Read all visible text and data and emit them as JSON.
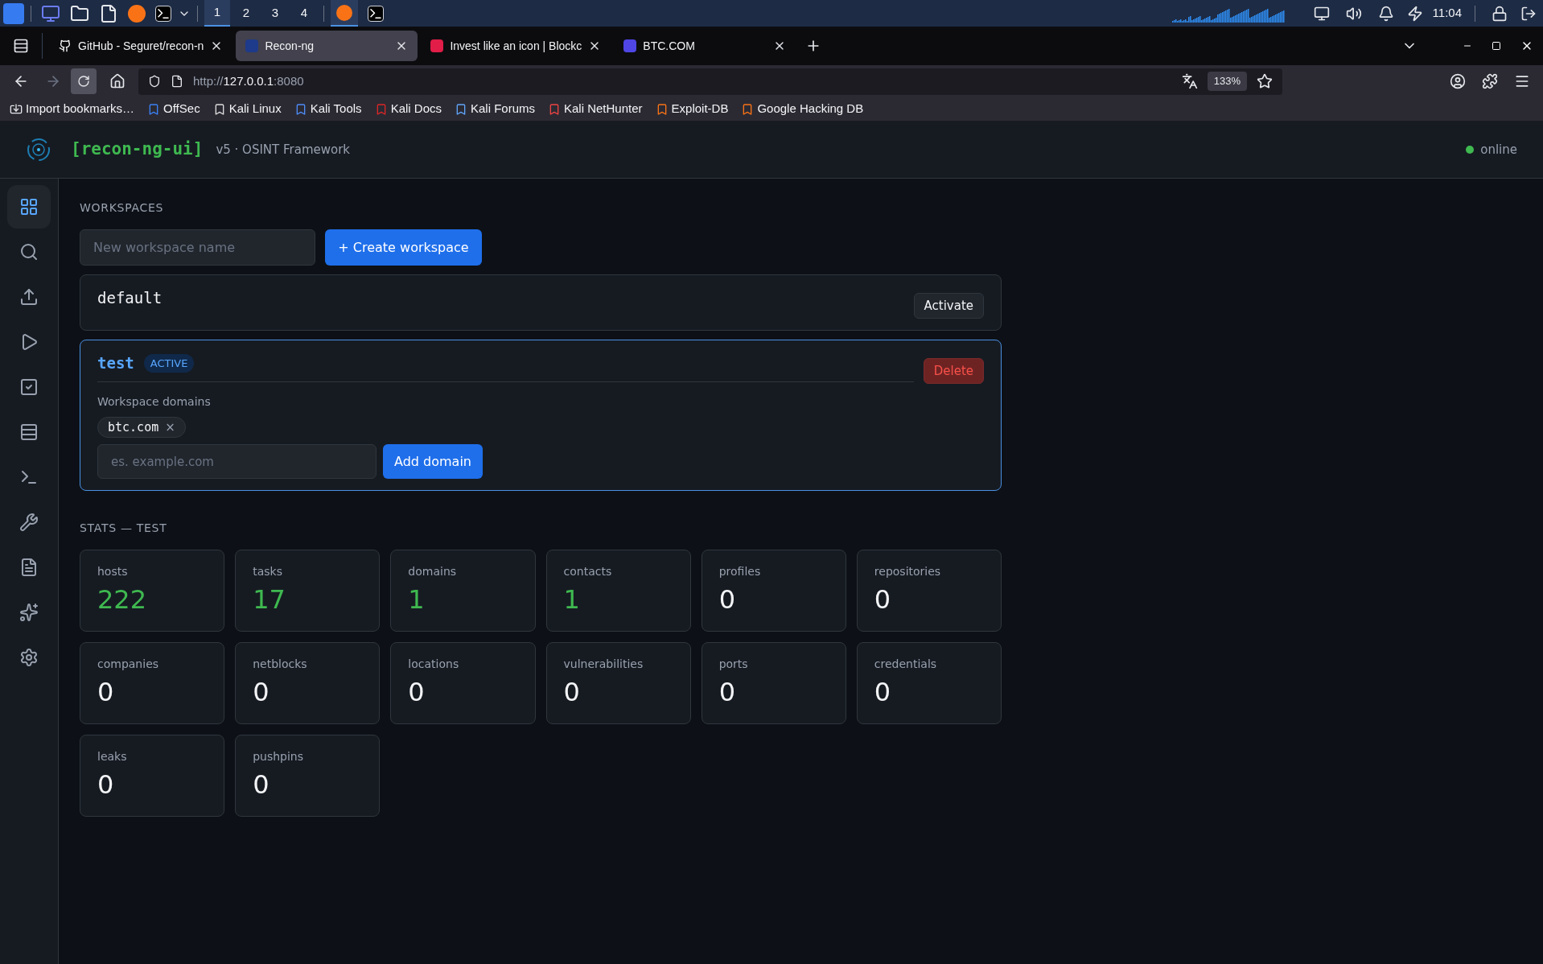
{
  "taskbar": {
    "workspaces": [
      {
        "label": "1",
        "selected": true
      },
      {
        "label": "2",
        "selected": false
      },
      {
        "label": "3",
        "selected": false
      },
      {
        "label": "4",
        "selected": false
      }
    ],
    "clock": "11:04"
  },
  "browser": {
    "tabs": [
      {
        "title": "GitHub - Seguret/recon-n",
        "selected": false
      },
      {
        "title": "Recon-ng",
        "selected": true
      },
      {
        "title": "Invest like an icon | Blockc",
        "selected": false
      },
      {
        "title": "BTC.COM",
        "selected": false
      }
    ],
    "url": {
      "scheme": "http://",
      "host": "127.0.0.1",
      "port": ":8080"
    },
    "zoom": "133%",
    "bookmarks": [
      "Import bookmarks…",
      "OffSec",
      "Kali Linux",
      "Kali Tools",
      "Kali Docs",
      "Kali Forums",
      "Kali NetHunter",
      "Exploit-DB",
      "Google Hacking DB"
    ]
  },
  "app": {
    "title": "[recon-ng-ui]",
    "subtitle": "v5 · OSINT Framework",
    "status": "online",
    "online": true
  },
  "sidebar": {
    "items": [
      {
        "selected": true
      },
      {
        "selected": false
      },
      {
        "selected": false
      },
      {
        "selected": false
      },
      {
        "selected": false
      },
      {
        "selected": false
      },
      {
        "selected": false
      },
      {
        "selected": false
      },
      {
        "selected": false
      },
      {
        "selected": false
      },
      {
        "selected": false
      }
    ]
  },
  "workspaces": {
    "heading": "WORKSPACES",
    "name_placeholder": "New workspace name",
    "create_button": "+ Create workspace",
    "items": [
      {
        "name": "default",
        "active": false,
        "action": "Activate"
      },
      {
        "name": "test",
        "active": true,
        "badge": "ACTIVE",
        "action": "Delete",
        "domains_label": "Workspace domains",
        "domains": [
          {
            "name": "btc.com",
            "remove": "×"
          }
        ],
        "domain_placeholder": "es. example.com",
        "add_button": "Add domain"
      }
    ]
  },
  "stats": {
    "heading": "STATS — TEST",
    "items": [
      {
        "label": "hosts",
        "value": "222",
        "highlight": true
      },
      {
        "label": "tasks",
        "value": "17",
        "highlight": true
      },
      {
        "label": "domains",
        "value": "1",
        "highlight": true
      },
      {
        "label": "contacts",
        "value": "1",
        "highlight": true
      },
      {
        "label": "profiles",
        "value": "0",
        "highlight": false
      },
      {
        "label": "repositories",
        "value": "0",
        "highlight": false
      },
      {
        "label": "companies",
        "value": "0",
        "highlight": false
      },
      {
        "label": "netblocks",
        "value": "0",
        "highlight": false
      },
      {
        "label": "locations",
        "value": "0",
        "highlight": false
      },
      {
        "label": "vulnerabilities",
        "value": "0",
        "highlight": false
      },
      {
        "label": "ports",
        "value": "0",
        "highlight": false
      },
      {
        "label": "credentials",
        "value": "0",
        "highlight": false
      },
      {
        "label": "leaks",
        "value": "0",
        "highlight": false
      },
      {
        "label": "pushpins",
        "value": "0",
        "highlight": false
      }
    ]
  }
}
